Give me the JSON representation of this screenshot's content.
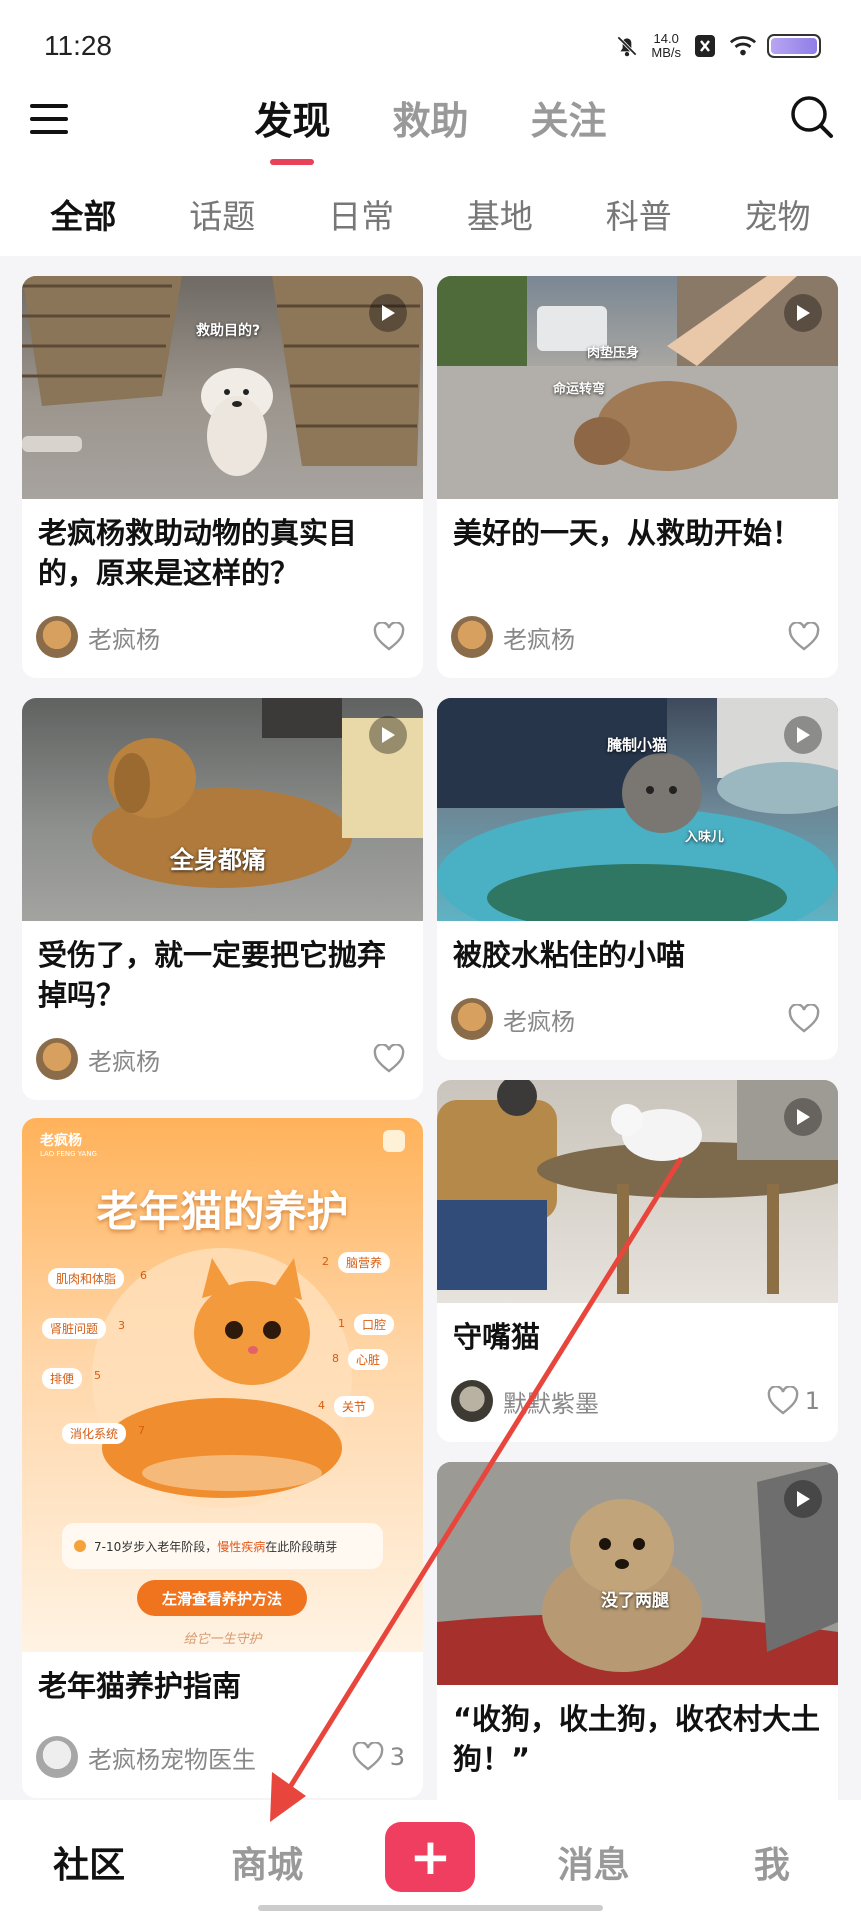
{
  "status": {
    "time": "11:28",
    "speed_value": "14.0",
    "speed_unit": "MB/s"
  },
  "header": {
    "tabs": [
      {
        "label": "发现",
        "active": true
      },
      {
        "label": "救助",
        "active": false
      },
      {
        "label": "关注",
        "active": false
      }
    ]
  },
  "categories": [
    "全部",
    "话题",
    "日常",
    "基地",
    "科普",
    "宠物"
  ],
  "feed": {
    "cards": [
      {
        "title": "老疯杨救助动物的真实目的，原来是这样的？",
        "author": "老疯杨",
        "likes": "",
        "overlay": "救助目的?"
      },
      {
        "title": "美好的一天，从救助开始！",
        "author": "老疯杨",
        "likes": "",
        "overlay": "肉垫压身",
        "overlay2": "命运转弯"
      },
      {
        "title": "受伤了，就一定要把它抛弃掉吗？",
        "author": "老疯杨",
        "likes": "",
        "overlay": "全身都痛"
      },
      {
        "title": "被胶水粘住的小喵",
        "author": "老疯杨",
        "likes": "",
        "overlay": "腌制小猫",
        "overlay2": "入味儿"
      },
      {
        "title": "老年猫养护指南",
        "author": "老疯杨宠物医生",
        "likes": "3"
      },
      {
        "title": "守嘴猫",
        "author": "默默紫墨",
        "likes": "1"
      },
      {
        "title": "“收狗，收土狗，收农村大土狗！”",
        "author": "",
        "likes": "",
        "overlay": "没了两腿"
      }
    ],
    "poster": {
      "brand": "老疯杨",
      "brand_sub": "LAO FENG YANG",
      "title": "老年猫的养护",
      "tags": [
        "肌肉和体脂",
        "6",
        "肾脏问题",
        "3",
        "排便",
        "5",
        "消化系统",
        "7",
        "脑营养",
        "2",
        "口腔",
        "1",
        "心脏",
        "8",
        "关节",
        "4"
      ],
      "note_prefix": "7-10岁步入老年阶段，",
      "note_highlight": "慢性疾病",
      "note_suffix": "在此阶段萌芽",
      "cta": "左滑查看养护方法",
      "signature": "给它一生守护"
    }
  },
  "bottom_nav": {
    "items": [
      "社区",
      "商城",
      "+",
      "消息",
      "我"
    ]
  },
  "colors": {
    "accent": "#ef3e5f",
    "annotation_arrow": "#e8453c"
  }
}
